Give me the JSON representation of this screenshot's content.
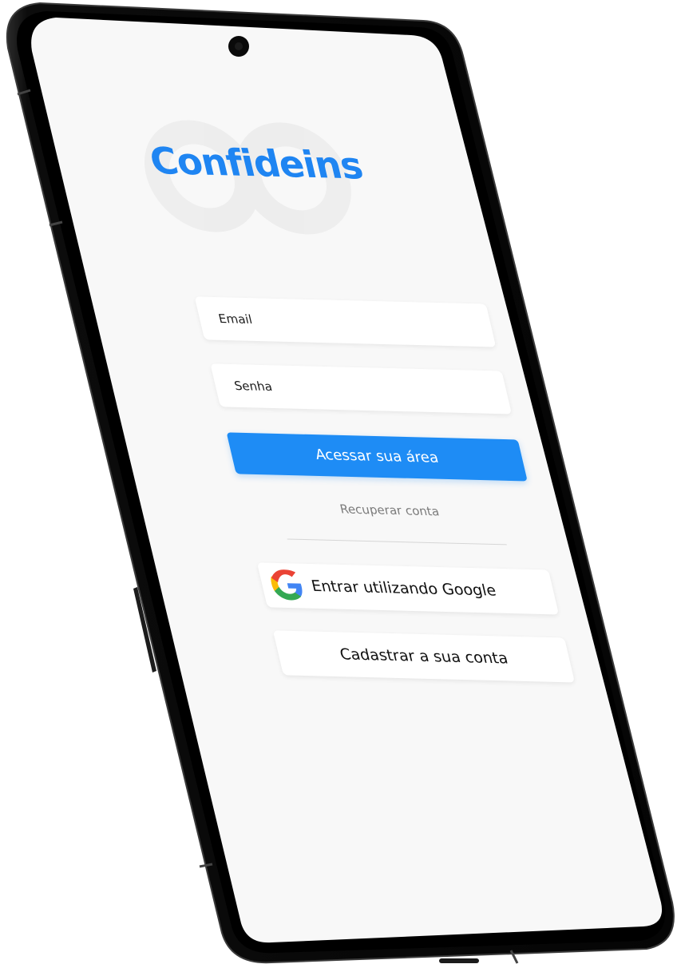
{
  "app": {
    "logo_text": "Confideins",
    "brand_color": "#1f85f2"
  },
  "login": {
    "email_placeholder": "Email",
    "password_placeholder": "Senha",
    "submit_label": "Acessar sua área",
    "recover_label": "Recuperar conta",
    "google_label": "Entrar utilizando Google",
    "register_label": "Cadastrar a sua conta",
    "primary_color": "#1e8cf5",
    "google_icon": "google-g-icon"
  }
}
